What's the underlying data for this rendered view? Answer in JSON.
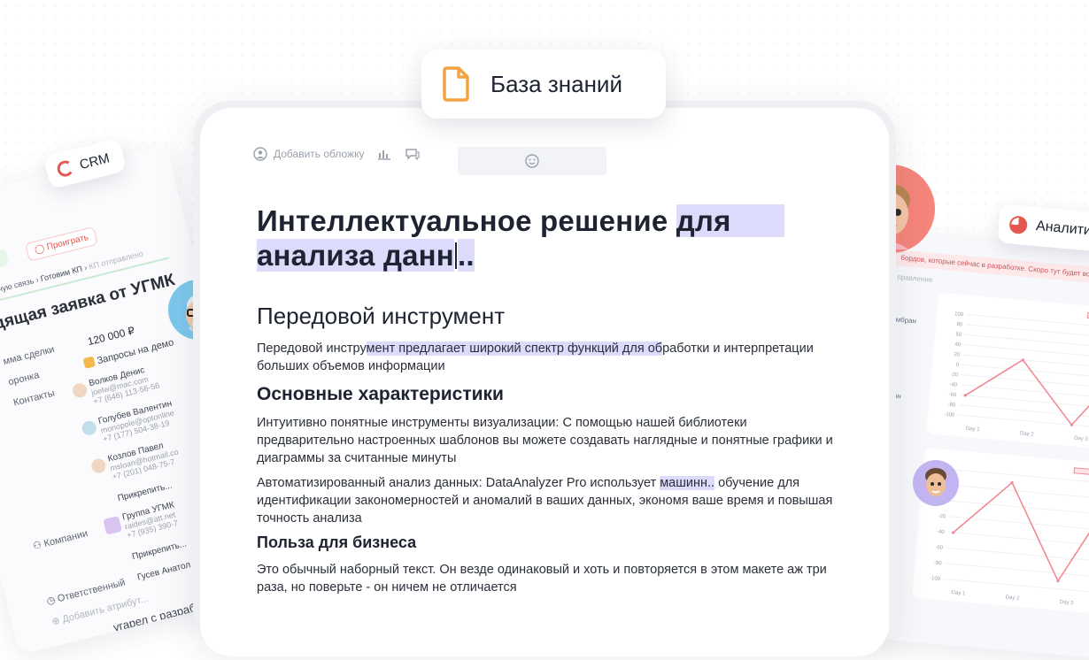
{
  "knowledge_chip": {
    "label": "База знаний",
    "icon": "document-icon",
    "accent": "#f4a340"
  },
  "crm_chip": {
    "label": "CRM",
    "icon": "crm-logo-icon",
    "accent": "#e4574f"
  },
  "analytics_chip": {
    "label": "Аналити",
    "icon": "pie-chart-icon",
    "accent": "#e4574f"
  },
  "toolbar": {
    "add_cover": "Добавить обложку",
    "icons": [
      "cover-icon",
      "chart-icon",
      "comment-icon"
    ],
    "emoji_icon": "smile-icon"
  },
  "doc": {
    "title_plain": "Интеллектуальное решение ",
    "title_hl1": "для",
    "title_hl2": "анализа данн",
    "title_tail": "..",
    "h2": "Передовой инструмент",
    "p1_a": "Передовой инстру",
    "p1_hl": "мент предлагает широкий спектр функций для об",
    "p1_b": "работки и интерпретации больших объемов информации",
    "h3": "Основные характеристики",
    "p2": " Интуитивно понятные инструменты визуализации: С помощью нашей библиотеки предварительно настроенных шаблонов вы можете создавать наглядные и понятные графики и диаграммы за считанные минуты",
    "p3_a": "Автоматизированный анализ данных: DataAnalyzer Pro использует ",
    "p3_hl": "машинн..",
    "p3_b": " обучение для идентификации закономерностей и аномалий в ваших данных, экономя ваше время и повышая точность анализа",
    "h4": "Польза для бизнеса",
    "p4": "Это обычный наборный текст. Он везде одинаковый и хоть и повторяется в этом макете аж три раза, но поверьте - он ничем не отличается"
  },
  "crm": {
    "stage_won": "рать",
    "stage_lost": "Проиграть",
    "crumb1": "ратную связь",
    "crumb2": "Готовим КП",
    "crumb3": "КП отправлено",
    "deal_title": "дящая заявка от УГМК",
    "field_amount_label": "мма сделки",
    "amount": "120 000 ₽",
    "field_funnel": "оронка",
    "requests": "Запросы на демо",
    "field_contacts": "Контакты",
    "contacts": [
      {
        "name": "Волков Денис",
        "email": "joelw@mac.com",
        "phone": "+7 (646) 113-56-56"
      },
      {
        "name": "Голубев Валентин",
        "email": "monopole@optonline",
        "phone": "+7 (177) 504-38-19"
      },
      {
        "name": "Козлов Павел",
        "email": "msloan@hotmail.co",
        "phone": "+7 (201) 048-75-7"
      }
    ],
    "attach1": "Прикрепить...",
    "field_companies": "Компании",
    "company": {
      "name": "Группа УГМК",
      "email": "raides@att.net",
      "phone": "+7 (935) 390-7"
    },
    "attach2": "Прикрепить...",
    "field_responsible": "Ответственный",
    "responsible": "Гусев Анатол",
    "add_attr": "Добавить атрибут...",
    "footer": "угарел с разраб"
  },
  "analytics": {
    "banner": "бордов, которые сейчас в разработке. Скоро тут будет возм",
    "crumb": "правления",
    "left_labels": [
      "ямбран",
      "бран"
    ],
    "chart1": {
      "type": "line",
      "x": [
        "Day 1",
        "Day 2",
        "Day 3"
      ],
      "y_ticks": [
        100,
        80,
        60,
        40,
        20,
        0,
        -20,
        -40,
        -60,
        -80,
        -100
      ],
      "values": [
        -60,
        20,
        -100,
        40
      ],
      "color": "#f08a95"
    },
    "chart2": {
      "type": "line",
      "legend": "Delta Data",
      "x": [
        "Day 1",
        "Day 2",
        "Day 3"
      ],
      "y_ticks": [
        40,
        20,
        0,
        -20,
        -40,
        -60,
        -80,
        -100
      ],
      "values": [
        -40,
        30,
        -90,
        40
      ],
      "color": "#f08a95"
    }
  }
}
